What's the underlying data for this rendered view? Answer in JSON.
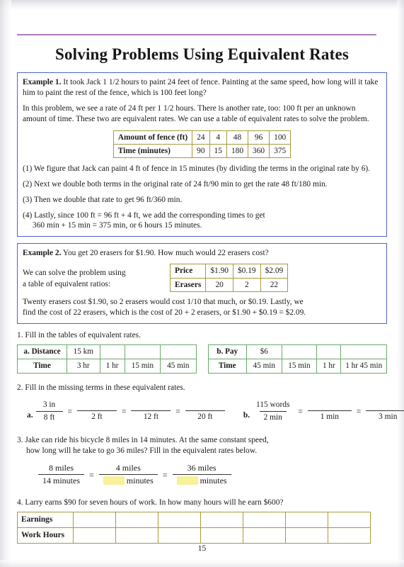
{
  "page": {
    "title": "Solving Problems Using Equivalent Rates",
    "page_number": "15",
    "rule_color": "#b07cc0",
    "example_border_color": "#4a66c8",
    "olive_border_color": "#a79a3c",
    "green_border_color": "#6aa96a",
    "highlight_color": "#f8f09a"
  },
  "example1": {
    "label": "Example 1.",
    "para1": "It took Jack 1 1/2 hours to paint 24 feet of fence. Painting at the same speed, how long will it take him to paint the rest of the fence, which is 100 feet long?",
    "para2": "In this problem, we see a rate of 24 ft per 1 1/2 hours. There is another rate, too: 100 ft per an unknown amount of time. These two are equivalent rates. We can use a table of equivalent rates to solve the problem.",
    "table": {
      "rows": [
        {
          "header": "Amount of fence (ft)",
          "cells": [
            "24",
            "4",
            "48",
            "96",
            "100"
          ]
        },
        {
          "header": "Time (minutes)",
          "cells": [
            "90",
            "15",
            "180",
            "360",
            "375"
          ]
        }
      ]
    },
    "steps": [
      "(1) We figure that Jack can paint 4 ft of fence in 15 minutes (by dividing the terms in the original rate by 6).",
      "(2) Next we double both terms in the original rate of 24 ft/90 min to get the rate 48 ft/180 min.",
      "(3) Then we double that rate to get 96 ft/360 min."
    ],
    "step4_line1": "(4) Lastly, since 100 ft = 96 ft + 4 ft, we add the corresponding times to get",
    "step4_line2": "360 min + 15 min = 375 min, or 6 hours 15 minutes."
  },
  "example2": {
    "label": "Example 2.",
    "para1": "You get 20 erasers for $1.90. How much would 22 erasers cost?",
    "side_text_line1": "We can solve the problem using",
    "side_text_line2": "a table of equivalent ratios:",
    "table": {
      "rows": [
        {
          "header": "Price",
          "cells": [
            "$1.90",
            "$0.19",
            "$2.09"
          ]
        },
        {
          "header": "Erasers",
          "cells": [
            "20",
            "2",
            "22"
          ]
        }
      ]
    },
    "closing_line1": "Twenty erasers cost $1.90, so 2 erasers would cost 1/10 that much, or $0.19. Lastly, we",
    "closing_line2": "find the cost of 22 erasers, which is the cost of 20 + 2 erasers, or $1.90 + $0.19 = $2.09."
  },
  "exercise1": {
    "number": "1.",
    "question": "Fill in the tables of equivalent rates.",
    "table_a": {
      "rows": [
        {
          "header": "a. Distance",
          "cells": [
            "15 km",
            "",
            "",
            ""
          ]
        },
        {
          "header": "Time",
          "cells": [
            "3 hr",
            "1 hr",
            "15 min",
            "45 min"
          ]
        }
      ]
    },
    "table_b": {
      "rows": [
        {
          "header": "b. Pay",
          "cells": [
            "$6",
            "",
            "",
            ""
          ]
        },
        {
          "header": "Time",
          "cells": [
            "45 min",
            "15 min",
            "1 hr",
            "1 hr 45 min"
          ]
        }
      ]
    }
  },
  "exercise2": {
    "number": "2.",
    "question": "Fill in the missing terms in these equivalent rates.",
    "part_a": {
      "label": "a.",
      "fractions": [
        {
          "num": "3 in",
          "den": "8 ft"
        },
        {
          "num": "",
          "den": "2 ft"
        },
        {
          "num": "",
          "den": "12 ft"
        },
        {
          "num": "",
          "den": "20 ft"
        }
      ]
    },
    "part_b": {
      "label": "b.",
      "fractions": [
        {
          "num": "115 words",
          "den": "2 min"
        },
        {
          "num": "",
          "den": "1 min"
        },
        {
          "num": "",
          "den": "3 min"
        }
      ]
    },
    "equals": "="
  },
  "exercise3": {
    "number": "3.",
    "question_line1": "Jake can ride his bicycle 8 miles in 14 minutes. At the same constant speed,",
    "question_line2": "how long will he take to go 36 miles? Fill in the equivalent rates below.",
    "fractions": [
      {
        "num": "8 miles",
        "den": "14 minutes",
        "den_highlight": false
      },
      {
        "num": "4 miles",
        "den": "minutes",
        "den_highlight": true
      },
      {
        "num": "36 miles",
        "den": "minutes",
        "den_highlight": true
      }
    ],
    "equals": "="
  },
  "exercise4": {
    "number": "4.",
    "question": "Larry earns $90 for seven hours of work. In how many hours will he earn $600?",
    "table": {
      "rows": [
        {
          "header": "Earnings",
          "cells": [
            "",
            "",
            "",
            "",
            "",
            "",
            ""
          ]
        },
        {
          "header": "Work Hours",
          "cells": [
            "",
            "",
            "",
            "",
            "",
            "",
            ""
          ]
        }
      ]
    }
  }
}
